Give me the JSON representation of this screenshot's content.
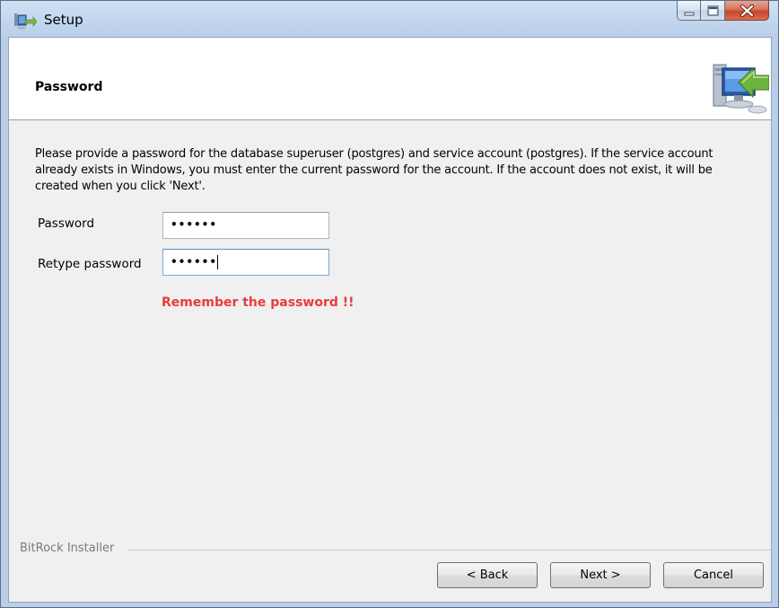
{
  "window": {
    "title": "Setup"
  },
  "header": {
    "title": "Password",
    "icon": "computer-with-arrow-icon"
  },
  "description": "Please provide a password for the database superuser (postgres) and service account (postgres). If the service account already exists in Windows, you must enter the current password for the account. If the account does not exist, it will be created when you click 'Next'.",
  "form": {
    "password_label": "Password",
    "password_value": "••••••",
    "retype_label": "Retype password",
    "retype_value": "••••••"
  },
  "warning": "Remember the password !!",
  "footer": {
    "brand": "BitRock Installer",
    "back_label": "< Back",
    "next_label": "Next >",
    "cancel_label": "Cancel"
  },
  "colors": {
    "warning": "#e83b3b",
    "titlebar": "#c2d7ee",
    "close_button": "#c7472a"
  }
}
